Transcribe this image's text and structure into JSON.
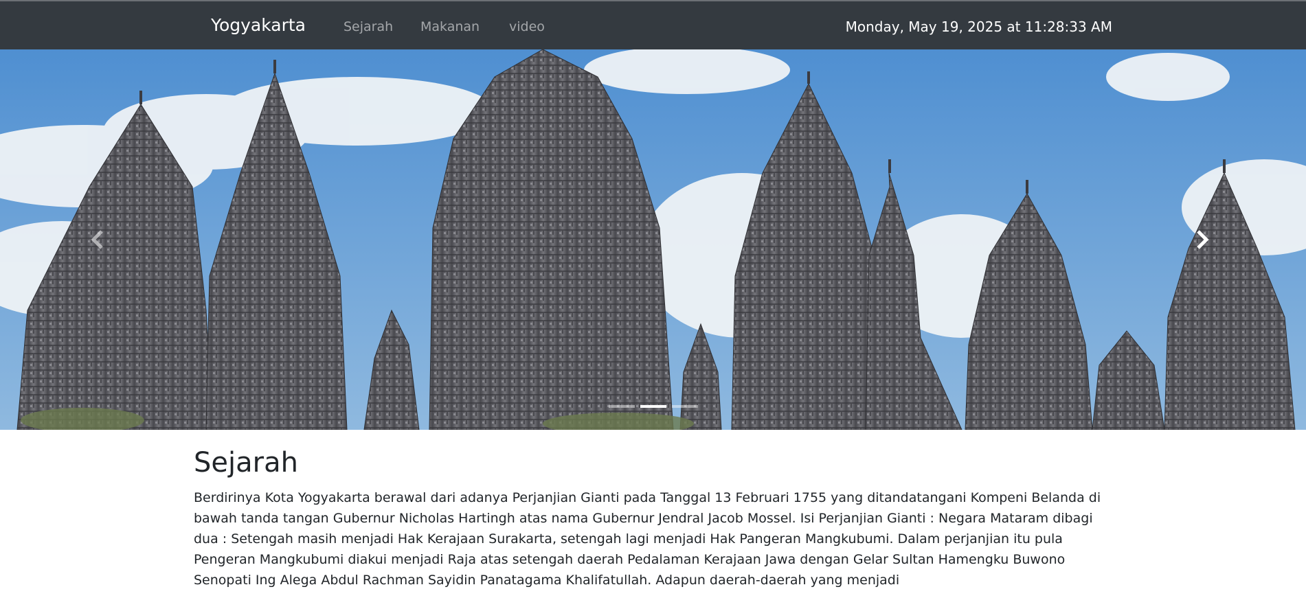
{
  "navbar": {
    "brand": "Yogyakarta",
    "links": [
      "Sejarah",
      "Makanan",
      "video"
    ],
    "datetime": "Monday, May 19, 2025 at 11:28:33 AM"
  },
  "carousel": {
    "image_description_icon": "temple-photo",
    "prev_icon": "chevron-left-icon",
    "next_icon": "chevron-right-icon",
    "slide_count": 3,
    "active_slide_number": 2
  },
  "section": {
    "title": "Sejarah",
    "body": "Berdirinya Kota Yogyakarta berawal dari adanya Perjanjian Gianti pada Tanggal 13 Februari 1755 yang ditandatangani Kompeni Belanda di bawah tanda tangan Gubernur Nicholas Hartingh atas nama Gubernur Jendral Jacob Mossel. Isi Perjanjian Gianti : Negara Mataram dibagi dua : Setengah masih menjadi Hak Kerajaan Surakarta, setengah lagi menjadi Hak Pangeran Mangkubumi. Dalam perjanjian itu pula Pengeran Mangkubumi diakui menjadi Raja atas setengah daerah Pedalaman Kerajaan Jawa dengan Gelar Sultan Hamengku Buwono Senopati Ing Alega Abdul Rachman Sayidin Panatagama Khalifatullah. Adapun daerah-daerah yang menjadi"
  },
  "colors": {
    "navbar_bg": "#343a40",
    "sky": "#6a9fd0",
    "stone": "#5d5d62"
  }
}
